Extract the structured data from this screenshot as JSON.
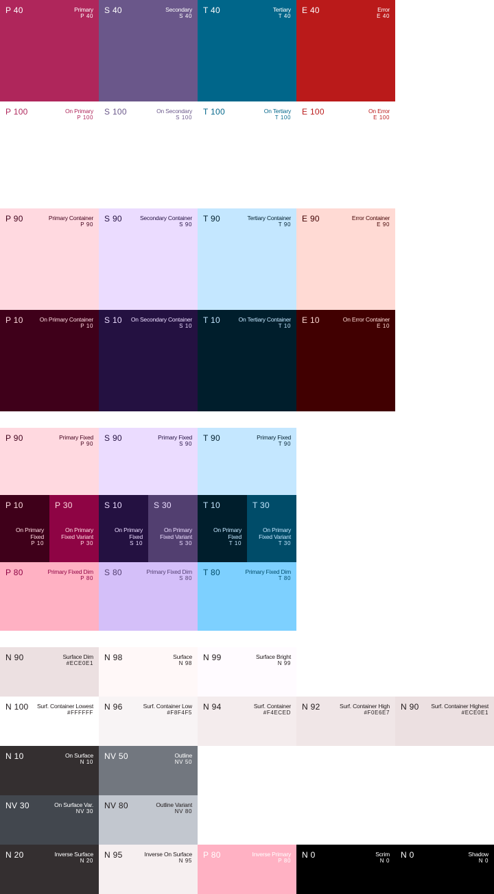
{
  "swatches": [
    {
      "key": "primary",
      "tone": "P 40",
      "role": "Primary",
      "code": "P 40",
      "bg": "#AF265B",
      "fg": "#FFFFFF"
    },
    {
      "key": "secondary",
      "tone": "S 40",
      "role": "Secondary",
      "code": "S 40",
      "bg": "#6A578A",
      "fg": "#FFFFFF"
    },
    {
      "key": "tertiary",
      "tone": "T 40",
      "role": "Tertiary",
      "code": "T 40",
      "bg": "#00668A",
      "fg": "#FFFFFF"
    },
    {
      "key": "error",
      "tone": "E 40",
      "role": "Error",
      "code": "E 40",
      "bg": "#BA1A1A",
      "fg": "#FFFFFF"
    },
    {
      "key": "on-primary",
      "tone": "P 100",
      "role": "On Primary",
      "code": "P 100",
      "bg": "#FFFFFF",
      "fg": "#AF265B"
    },
    {
      "key": "on-secondary",
      "tone": "S 100",
      "role": "On Secondary",
      "code": "S 100",
      "bg": "#FFFFFF",
      "fg": "#6A578A"
    },
    {
      "key": "on-tertiary",
      "tone": "T 100",
      "role": "On Tertiary",
      "code": "T 100",
      "bg": "#FFFFFF",
      "fg": "#00668A"
    },
    {
      "key": "on-error",
      "tone": "E 100",
      "role": "On Error",
      "code": "E 100",
      "bg": "#FFFFFF",
      "fg": "#BA1A1A"
    },
    {
      "key": "primary-container",
      "tone": "P 90",
      "role": "Primary Container",
      "code": "P 90",
      "bg": "#FFD9E0",
      "fg": "#3F001A"
    },
    {
      "key": "secondary-container",
      "tone": "S 90",
      "role": "Secondary Container",
      "code": "S 90",
      "bg": "#EBDCFF",
      "fg": "#241141"
    },
    {
      "key": "tertiary-container",
      "tone": "T 90",
      "role": "Tertiary Container",
      "code": "T 90",
      "bg": "#C4E7FF",
      "fg": "#001E2C"
    },
    {
      "key": "error-container",
      "tone": "E 90",
      "role": "Error Container",
      "code": "E 90",
      "bg": "#FFDAD4",
      "fg": "#410001"
    },
    {
      "key": "on-primary-container",
      "tone": "P 10",
      "role": "On Primary Container",
      "code": "P 10",
      "bg": "#3F001A",
      "fg": "#FFD9E0"
    },
    {
      "key": "on-secondary-container",
      "tone": "S 10",
      "role": "On Secondary Container",
      "code": "S 10",
      "bg": "#241141",
      "fg": "#EBDCFF"
    },
    {
      "key": "on-tertiary-container",
      "tone": "T 10",
      "role": "On Tertiary Container",
      "code": "T 10",
      "bg": "#001E2C",
      "fg": "#C4E7FF"
    },
    {
      "key": "on-error-container",
      "tone": "E 10",
      "role": "On Error Container",
      "code": "E 10",
      "bg": "#410001",
      "fg": "#FFDAD4"
    },
    {
      "key": "primary-fixed",
      "tone": "P 90",
      "role": "Primary Fixed",
      "code": "P 90",
      "bg": "#FFD9E0",
      "fg": "#3F001A"
    },
    {
      "key": "secondary-fixed",
      "tone": "S 90",
      "role": "Primary Fixed",
      "code": "S 90",
      "bg": "#EBDCFF",
      "fg": "#241141"
    },
    {
      "key": "tertiary-fixed",
      "tone": "T 90",
      "role": "Primary Fixed",
      "code": "T 90",
      "bg": "#C4E7FF",
      "fg": "#001E2C"
    },
    {
      "key": "on-primary-fixed",
      "tone": "P 10",
      "role": "On Primary Fixed",
      "code": "P 10",
      "bg": "#3F001A",
      "fg": "#FFD9E0"
    },
    {
      "key": "on-primary-fixed-variant",
      "tone": "P 30",
      "role": "On Primary Fixed Variant",
      "code": "P 30",
      "bg": "#8E0444",
      "fg": "#FFD9E0"
    },
    {
      "key": "on-secondary-fixed",
      "tone": "S 10",
      "role": "On Primary Fixed",
      "code": "S 10",
      "bg": "#241141",
      "fg": "#EBDCFF"
    },
    {
      "key": "on-secondary-fixed-variant",
      "tone": "S 30",
      "role": "On Primary Fixed Variant",
      "code": "S 30",
      "bg": "#523F70",
      "fg": "#EBDCFF"
    },
    {
      "key": "on-tertiary-fixed",
      "tone": "T 10",
      "role": "On Primary Fixed",
      "code": "T 10",
      "bg": "#001E2C",
      "fg": "#C4E7FF"
    },
    {
      "key": "on-tertiary-fixed-variant",
      "tone": "T 30",
      "role": "On Primary Fixed Variant",
      "code": "T 30",
      "bg": "#004C69",
      "fg": "#C4E7FF"
    },
    {
      "key": "primary-fixed-dim",
      "tone": "P 80",
      "role": "Primary Fixed Dim",
      "code": "P 80",
      "bg": "#FFB1C3",
      "fg": "#8E0444"
    },
    {
      "key": "secondary-fixed-dim",
      "tone": "S 80",
      "role": "Primary Fixed Dim",
      "code": "S 80",
      "bg": "#D4BFF9",
      "fg": "#523F70"
    },
    {
      "key": "tertiary-fixed-dim",
      "tone": "T 80",
      "role": "Primary Fixed Dim",
      "code": "T 80",
      "bg": "#7DD0FF",
      "fg": "#004C69"
    },
    {
      "key": "surface-dim",
      "tone": "N 90",
      "role": "Surface Dim",
      "code": "#ECE0E1",
      "bg": "#ECE0E1",
      "fg": "#201A1B"
    },
    {
      "key": "surface",
      "tone": "N 98",
      "role": "Surface",
      "code": "N 98",
      "bg": "#FFF8F8",
      "fg": "#201A1B"
    },
    {
      "key": "surface-bright",
      "tone": "N 99",
      "role": "Surface Bright",
      "code": "N 99",
      "bg": "#FFFBFF",
      "fg": "#201A1B"
    },
    {
      "key": "surface-container-lowest",
      "tone": "N 100",
      "role": "Surf. Container Lowest",
      "code": "#FFFFFF",
      "bg": "#FFFFFF",
      "fg": "#201A1B"
    },
    {
      "key": "surface-container-low",
      "tone": "N 96",
      "role": "Surf. Container Low",
      "code": "#F8F4F5",
      "bg": "#F8F4F5",
      "fg": "#201A1B"
    },
    {
      "key": "surface-container",
      "tone": "N 94",
      "role": "Surf. Container",
      "code": "#F4ECED",
      "bg": "#F4ECED",
      "fg": "#201A1B"
    },
    {
      "key": "surface-container-high",
      "tone": "N 92",
      "role": "Surf. Container High",
      "code": "#F0E6E7",
      "bg": "#F0E6E7",
      "fg": "#201A1B"
    },
    {
      "key": "surface-container-highest",
      "tone": "N 90",
      "role": "Surf. Container Highest",
      "code": "#ECE0E1",
      "bg": "#ECE0E1",
      "fg": "#201A1B"
    },
    {
      "key": "on-surface",
      "tone": "N 10",
      "role": "On Surface",
      "code": "N 10",
      "bg": "#342F30",
      "fg": "#FFFFFF"
    },
    {
      "key": "outline",
      "tone": "NV 50",
      "role": "Outline",
      "code": "NV 50",
      "bg": "#72777F",
      "fg": "#FFFFFF"
    },
    {
      "key": "on-surface-variant",
      "tone": "NV 30",
      "role": "On Surface Var.",
      "code": "NV 30",
      "bg": "#42474E",
      "fg": "#FFFFFF"
    },
    {
      "key": "outline-variant",
      "tone": "NV 80",
      "role": "Outline Variant",
      "code": "NV 80",
      "bg": "#C2C7CF",
      "fg": "#201A1B"
    },
    {
      "key": "inverse-surface",
      "tone": "N 20",
      "role": "Inverse Surface",
      "code": "N 20",
      "bg": "#342F30",
      "fg": "#FFFFFF"
    },
    {
      "key": "inverse-on-surface",
      "tone": "N 95",
      "role": "Inverse On Surface",
      "code": "N 95",
      "bg": "#F6EFF0",
      "fg": "#201A1B"
    },
    {
      "key": "inverse-primary",
      "tone": "P 80",
      "role": "Inverse Primary",
      "code": "P 80",
      "bg": "#FFB1C3",
      "fg": "#FFFFFF"
    },
    {
      "key": "scrim",
      "tone": "N 0",
      "role": "Scrim",
      "code": "N 0",
      "bg": "#000000",
      "fg": "#FFFFFF"
    },
    {
      "key": "shadow",
      "tone": "N 0",
      "role": "Shadow",
      "code": "N 0",
      "bg": "#000000",
      "fg": "#FFFFFF"
    }
  ]
}
